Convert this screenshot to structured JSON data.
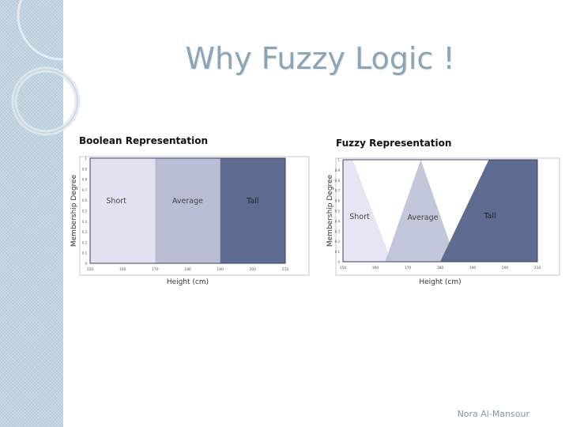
{
  "slide": {
    "title": "Why Fuzzy Logic !",
    "author": "Nora Al-Mansour"
  },
  "theme": {
    "band_color": "#b9cedc",
    "title_color": "#8aa5b7",
    "short_color": "#e3e1f1",
    "average_color": "#b9bdd4",
    "tall_color": "#5f6b90"
  },
  "boolean_chart": {
    "title": "Boolean Representation",
    "xlabel": "Height (cm)",
    "ylabel": "Membership Degree",
    "x_ticks": [
      "150",
      "160",
      "170",
      "180",
      "190",
      "200",
      "210"
    ],
    "y_ticks": [
      "1",
      "0.9",
      "0.8",
      "0.7",
      "0.6",
      "0.5",
      "0.4",
      "0.3",
      "0.2",
      "0.1",
      "0"
    ],
    "regions": [
      {
        "label": "Short",
        "from": 150,
        "to": 170
      },
      {
        "label": "Average",
        "from": 170,
        "to": 190
      },
      {
        "label": "Tall",
        "from": 190,
        "to": 210
      }
    ]
  },
  "fuzzy_chart": {
    "title": "Fuzzy Representation",
    "xlabel": "Height (cm)",
    "ylabel": "Membership Degree",
    "x_ticks": [
      "150",
      "160",
      "170",
      "180",
      "190",
      "200",
      "210"
    ],
    "y_ticks": [
      "1",
      "0.9",
      "0.8",
      "0.7",
      "0.6",
      "0.5",
      "0.4",
      "0.3",
      "0.2",
      "0.1",
      "0"
    ],
    "sets": [
      {
        "label": "Short",
        "points": [
          [
            150,
            1
          ],
          [
            153,
            1
          ],
          [
            165,
            0
          ]
        ]
      },
      {
        "label": "Average",
        "points": [
          [
            163,
            0
          ],
          [
            174,
            1
          ],
          [
            185,
            0
          ]
        ]
      },
      {
        "label": "Tall",
        "points": [
          [
            180,
            0
          ],
          [
            195,
            1
          ],
          [
            210,
            1
          ],
          [
            210,
            0
          ]
        ]
      }
    ]
  }
}
